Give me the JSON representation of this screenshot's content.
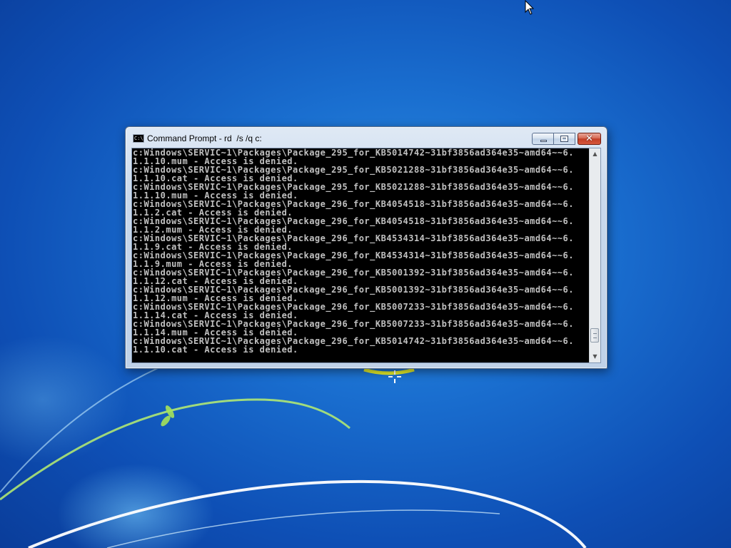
{
  "window": {
    "title": "Command Prompt - rd  /s /q c:",
    "icon": "cmd-icon",
    "icon_text": "C:\\",
    "close_glyph": "✕"
  },
  "console": {
    "lines": [
      "c:Windows\\SERVIC~1\\Packages\\Package_295_for_KB5014742~31bf3856ad364e35~amd64~~6.",
      "1.1.10.mum - Access is denied.",
      "c:Windows\\SERVIC~1\\Packages\\Package_295_for_KB5021288~31bf3856ad364e35~amd64~~6.",
      "1.1.10.cat - Access is denied.",
      "c:Windows\\SERVIC~1\\Packages\\Package_295_for_KB5021288~31bf3856ad364e35~amd64~~6.",
      "1.1.10.mum - Access is denied.",
      "c:Windows\\SERVIC~1\\Packages\\Package_296_for_KB4054518~31bf3856ad364e35~amd64~~6.",
      "1.1.2.cat - Access is denied.",
      "c:Windows\\SERVIC~1\\Packages\\Package_296_for_KB4054518~31bf3856ad364e35~amd64~~6.",
      "1.1.2.mum - Access is denied.",
      "c:Windows\\SERVIC~1\\Packages\\Package_296_for_KB4534314~31bf3856ad364e35~amd64~~6.",
      "1.1.9.cat - Access is denied.",
      "c:Windows\\SERVIC~1\\Packages\\Package_296_for_KB4534314~31bf3856ad364e35~amd64~~6.",
      "1.1.9.mum - Access is denied.",
      "c:Windows\\SERVIC~1\\Packages\\Package_296_for_KB5001392~31bf3856ad364e35~amd64~~6.",
      "1.1.12.cat - Access is denied.",
      "c:Windows\\SERVIC~1\\Packages\\Package_296_for_KB5001392~31bf3856ad364e35~amd64~~6.",
      "1.1.12.mum - Access is denied.",
      "c:Windows\\SERVIC~1\\Packages\\Package_296_for_KB5007233~31bf3856ad364e35~amd64~~6.",
      "1.1.14.cat - Access is denied.",
      "c:Windows\\SERVIC~1\\Packages\\Package_296_for_KB5007233~31bf3856ad364e35~amd64~~6.",
      "1.1.14.mum - Access is denied.",
      "c:Windows\\SERVIC~1\\Packages\\Package_296_for_KB5014742~31bf3856ad364e35~amd64~~6.",
      "1.1.10.cat - Access is denied."
    ],
    "text_color": "#c0c0c0",
    "background_color": "#000000",
    "scroll_position": 0.95
  },
  "scrollbar": {
    "up_arrow": "▲",
    "down_arrow": "▼"
  },
  "colors": {
    "desktop_blue": "#1a6fd0",
    "close_button_red": "#c13e27"
  },
  "desktop": {
    "cursor_icon": "arrow-cursor-icon",
    "busy_cursor_icon": "loading-cursor-icon"
  }
}
